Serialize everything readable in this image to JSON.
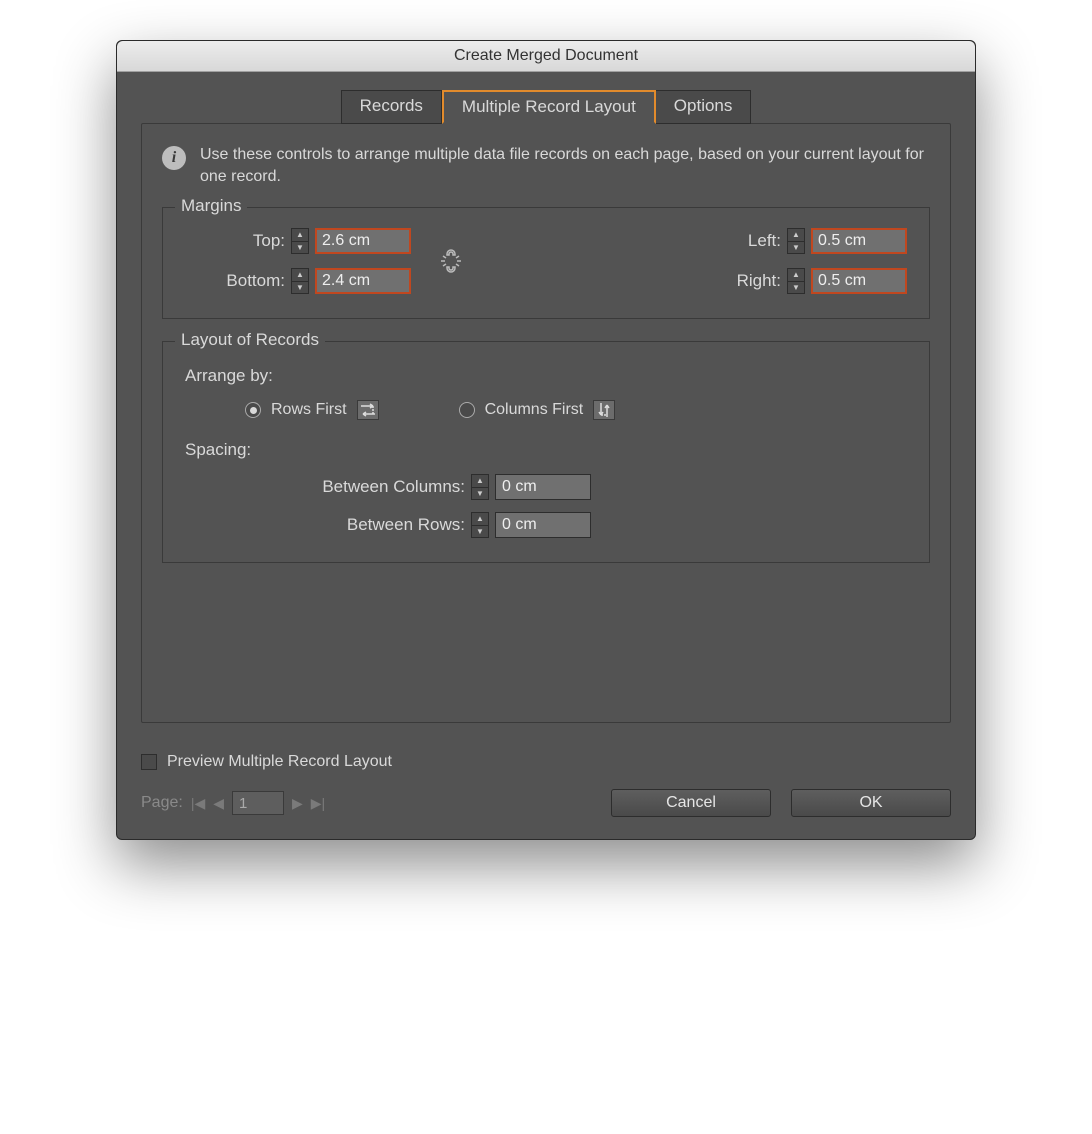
{
  "title": "Create Merged Document",
  "tabs": {
    "records": "Records",
    "layout": "Multiple Record Layout",
    "options": "Options",
    "active": "layout"
  },
  "info_text": "Use these controls to arrange multiple data file records on each page, based on your current layout for one record.",
  "margins": {
    "legend": "Margins",
    "top_label": "Top:",
    "top_value": "2.6 cm",
    "bottom_label": "Bottom:",
    "bottom_value": "2.4 cm",
    "left_label": "Left:",
    "left_value": "0.5 cm",
    "right_label": "Right:",
    "right_value": "0.5 cm",
    "linked": false
  },
  "layout_records": {
    "legend": "Layout of Records",
    "arrange_label": "Arrange by:",
    "rows_first": "Rows First",
    "columns_first": "Columns First",
    "selected": "rows_first",
    "spacing_label": "Spacing:",
    "between_columns_label": "Between Columns:",
    "between_columns_value": "0 cm",
    "between_rows_label": "Between Rows:",
    "between_rows_value": "0 cm"
  },
  "preview": {
    "label": "Preview Multiple Record Layout",
    "checked": false
  },
  "pager": {
    "label": "Page:",
    "value": "1"
  },
  "buttons": {
    "cancel": "Cancel",
    "ok": "OK"
  }
}
